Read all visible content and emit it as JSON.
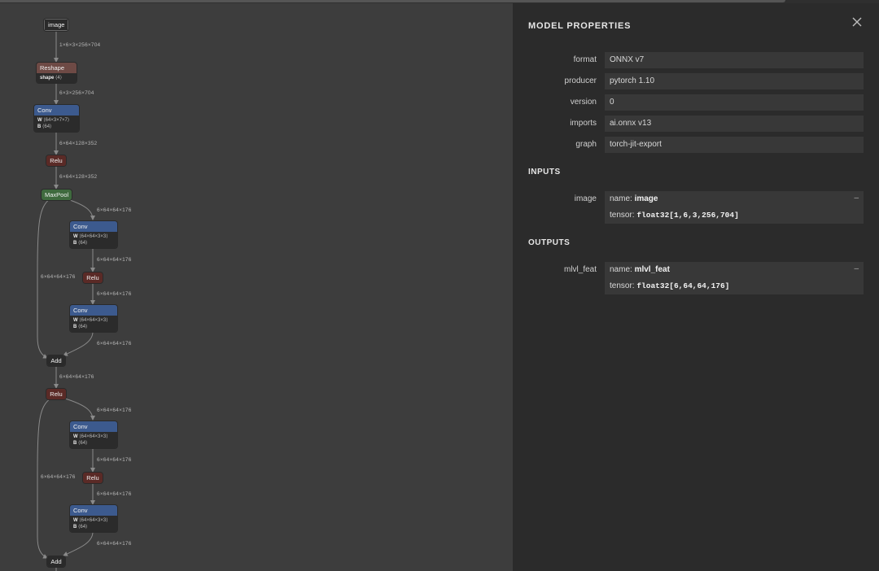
{
  "graph": {
    "nodes": {
      "image": "image",
      "reshape": "Reshape",
      "reshape_attr_key": "shape",
      "reshape_attr_val": "⟨4⟩",
      "conv": "Conv",
      "relu": "Relu",
      "maxpool": "MaxPool",
      "add": "Add",
      "w_key": "W",
      "b_key": "B",
      "w1": "⟨64×3×7×7⟩",
      "w2": "⟨64×64×3×3⟩",
      "b": "⟨64⟩"
    },
    "edge_labels": {
      "e1": "1×6×3×256×704",
      "e2": "6×3×256×704",
      "e3": "6×64×128×352",
      "e4": "6×64×128×352",
      "e5": "6×64×64×176",
      "e6": "6×64×64×176",
      "e7": "6×64×64×176",
      "e8": "6×64×64×176",
      "e9": "6×64×64×176",
      "e10": "6×64×64×176",
      "e11": "6×64×64×176",
      "e12": "6×64×64×176",
      "e13": "6×64×64×176",
      "e14": "6×64×64×176",
      "e15": "6×64×64×176"
    }
  },
  "sidebar": {
    "title": "MODEL PROPERTIES",
    "close_icon": "close-icon",
    "properties": [
      {
        "key": "format",
        "value": "ONNX v7"
      },
      {
        "key": "producer",
        "value": "pytorch 1.10"
      },
      {
        "key": "version",
        "value": "0"
      },
      {
        "key": "imports",
        "value": "ai.onnx v13"
      },
      {
        "key": "graph",
        "value": "torch-jit-export"
      }
    ],
    "inputs_title": "INPUTS",
    "input": {
      "key": "image",
      "name_label": "name: ",
      "name": "image",
      "tensor_label": "tensor: ",
      "tensor": "float32[1,6,3,256,704]",
      "toggle": "–"
    },
    "outputs_title": "OUTPUTS",
    "output": {
      "key": "mlvl_feat",
      "name_label": "name: ",
      "name": "mlvl_feat",
      "tensor_label": "tensor: ",
      "tensor": "float32[6,64,64,176]",
      "toggle": "–"
    }
  },
  "colors": {
    "canvas": "#3d3d3d",
    "sidebar": "#2b2b2b",
    "conv": "#3c5a8e",
    "relu": "#5a2a26",
    "maxpool": "#3f6a3e",
    "reshape": "#6e4a45"
  }
}
